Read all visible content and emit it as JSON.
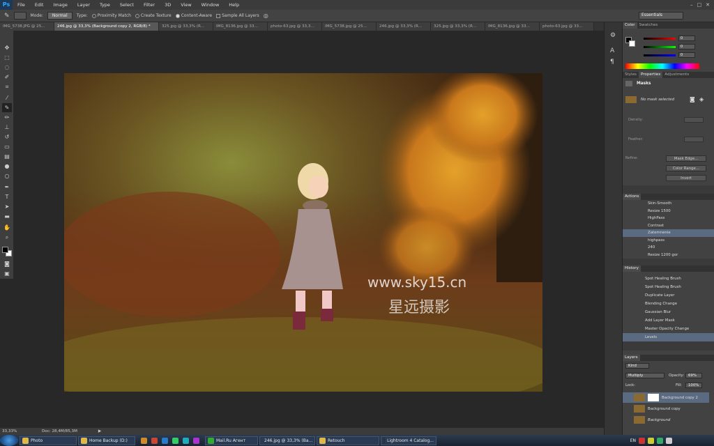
{
  "app": {
    "logo": "Ps",
    "accent": "#31a8ff"
  },
  "menus": [
    "File",
    "Edit",
    "Image",
    "Layer",
    "Type",
    "Select",
    "Filter",
    "3D",
    "View",
    "Window",
    "Help"
  ],
  "options": {
    "mode_label": "Mode:",
    "mode_value": "Normal",
    "type_label": "Type:",
    "type_options": [
      "Proximity Match",
      "Create Texture",
      "Content-Aware"
    ],
    "sample_all": "Sample All Layers",
    "workspace": "Essentials"
  },
  "tabs": [
    "IMG_5738.JPG @ 25...",
    "246.jpg @ 33,3% (Background copy 2, RGB/8) *",
    "325.jpg @ 33,3% (R...",
    "IMG_8136.jpg @ 33...",
    "photo-63.jpg @ 33,3...",
    "IMG_5738.jpg @ 25...",
    "246.jpg @ 33,3% (R...",
    "325.jpg @ 33,3% (R...",
    "IMG_8136.jpg @ 33...",
    "photo-63.jpg @ 33..."
  ],
  "status": {
    "zoom": "33,33%",
    "doc": "Doc: 28,4M/85,3M"
  },
  "watermark": {
    "url": "www.sky15.cn",
    "cn": "星远摄影"
  },
  "color_panel": {
    "tabs": [
      "Color",
      "Swatches"
    ],
    "r": "0",
    "g": "0",
    "b": "0"
  },
  "props_panel": {
    "tabs": [
      "Styles",
      "Properties",
      "Adjustments"
    ],
    "title": "Masks",
    "no_mask": "No mask selected",
    "density": "Density:",
    "feather": "Feather:",
    "refine": "Refine:",
    "mask_edge": "Mask Edge...",
    "color_range": "Color Range...",
    "invert": "Invert"
  },
  "actions": {
    "title": "Actions",
    "items": [
      "Skin-Smooth",
      "Resize 1500",
      "HighPass",
      "Contrast",
      "Zatemnenie",
      "highpass",
      "240",
      "Resize 1200 gor"
    ]
  },
  "history": {
    "title": "History",
    "items": [
      "Spot Healing Brush",
      "Spot Healing Brush",
      "Duplicate Layer",
      "Blending Change",
      "Gaussian Blur",
      "Add Layer Mask",
      "Master Opacity Change",
      "Levels"
    ]
  },
  "layers": {
    "title": "Layers",
    "kind": "Kind",
    "blend": "Multiply",
    "opacity_label": "Opacity:",
    "opacity": "69%",
    "lock_label": "Lock:",
    "fill_label": "Fill:",
    "fill": "100%",
    "items": [
      "Background copy 2",
      "Background copy",
      "Background"
    ]
  },
  "taskbar": {
    "items": [
      "Photo",
      "Home Backup (D:)",
      "Mail.Ru Агент",
      "246.jpg @ 33,3% (Ba...",
      "Retouch",
      "Lightroom 4 Catalog..."
    ],
    "lang": "EN"
  }
}
